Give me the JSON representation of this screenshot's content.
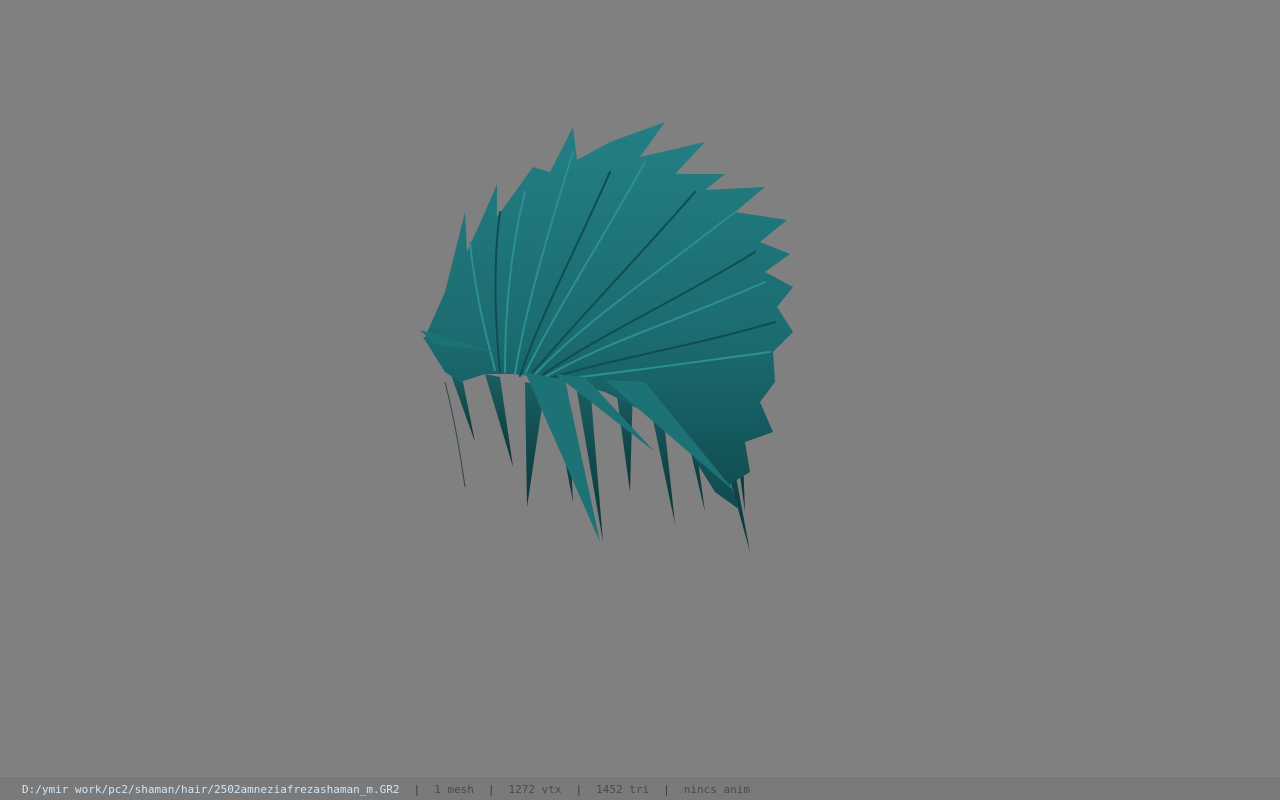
{
  "viewer": {
    "background_color": "#808080",
    "model": {
      "icon": "hair-mesh",
      "color": "#1b6c70"
    }
  },
  "statusbar": {
    "path": "D:/ymir work/pc2/shaman/hair/2502amneziafrezashaman_m.GR2",
    "separator": "|",
    "mesh": "1 mesh",
    "vtx": "1272 vtx",
    "tri": "1452 tri",
    "anim": "nincs anim"
  }
}
